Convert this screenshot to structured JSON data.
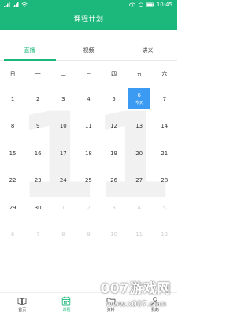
{
  "status_bar": {
    "time": "10:45",
    "battery_label": "▮"
  },
  "header": {
    "title": "课程计划"
  },
  "tabs": [
    {
      "label": "直播",
      "active": true
    },
    {
      "label": "视频",
      "active": false
    },
    {
      "label": "讲义",
      "active": false
    }
  ],
  "calendar": {
    "watermark_month": "11",
    "weekdays": [
      "日",
      "一",
      "二",
      "三",
      "四",
      "五",
      "六"
    ],
    "weeks": [
      [
        {
          "d": "1"
        },
        {
          "d": "2"
        },
        {
          "d": "3"
        },
        {
          "d": "4"
        },
        {
          "d": "5"
        },
        {
          "d": "6",
          "today": true,
          "sub": "今天"
        },
        {
          "d": "7"
        }
      ],
      [
        {
          "d": "8"
        },
        {
          "d": "9"
        },
        {
          "d": "10"
        },
        {
          "d": "11"
        },
        {
          "d": "12"
        },
        {
          "d": "13"
        },
        {
          "d": "14"
        }
      ],
      [
        {
          "d": "15"
        },
        {
          "d": "16"
        },
        {
          "d": "17"
        },
        {
          "d": "18"
        },
        {
          "d": "19"
        },
        {
          "d": "20"
        },
        {
          "d": "21"
        }
      ],
      [
        {
          "d": "22"
        },
        {
          "d": "23"
        },
        {
          "d": "24"
        },
        {
          "d": "25"
        },
        {
          "d": "26"
        },
        {
          "d": "27"
        },
        {
          "d": "28"
        }
      ],
      [
        {
          "d": "29"
        },
        {
          "d": "30"
        },
        {
          "d": "1",
          "dim": true
        },
        {
          "d": "2",
          "dim": true
        },
        {
          "d": "3",
          "dim": true
        },
        {
          "d": "4",
          "dim": true
        },
        {
          "d": "5",
          "dim": true
        }
      ],
      [
        {
          "d": "6",
          "dim": true
        },
        {
          "d": "7",
          "dim": true
        },
        {
          "d": "8",
          "dim": true
        },
        {
          "d": "9",
          "dim": true
        },
        {
          "d": "10",
          "dim": true
        },
        {
          "d": "11",
          "dim": true
        },
        {
          "d": "12",
          "dim": true
        }
      ]
    ]
  },
  "bottom_nav": [
    {
      "label": "首页",
      "icon": "book-icon",
      "active": false
    },
    {
      "label": "课程",
      "icon": "calendar-icon",
      "active": true
    },
    {
      "label": "资料",
      "icon": "folder-icon",
      "active": false
    },
    {
      "label": "我的",
      "icon": "user-icon",
      "active": false
    }
  ],
  "watermark": {
    "brand": "007游戏网",
    "url": "www.x007.com"
  },
  "colors": {
    "primary": "#1cb77a",
    "today": "#3b9af2",
    "dim_text": "#d0d0d0"
  }
}
